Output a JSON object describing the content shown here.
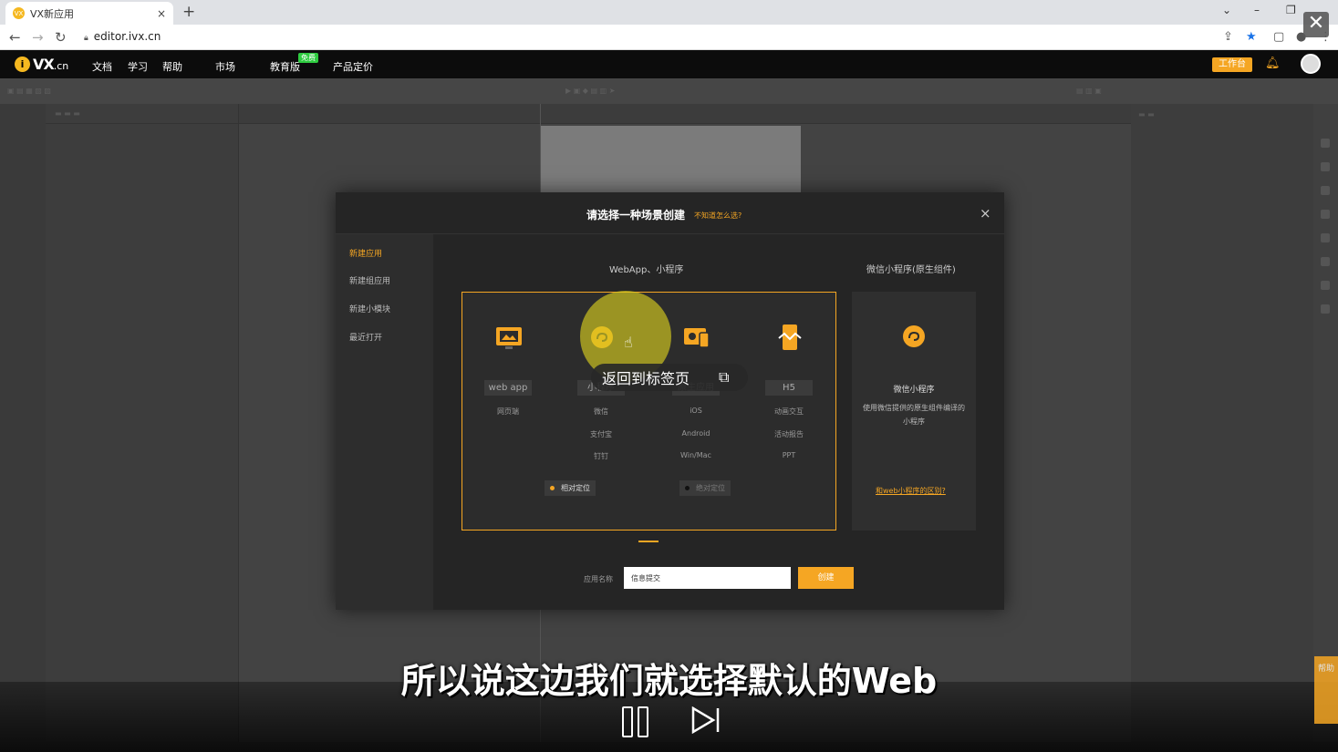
{
  "browser": {
    "tab_title": "VX新应用",
    "tab_close": "×",
    "new_tab": "+",
    "url": "editor.ivx.cn",
    "favicon": "VX"
  },
  "header": {
    "logo_text": "VX",
    "logo_suffix": ".cn",
    "nav": [
      "文档",
      "学习",
      "帮助",
      "市场",
      "教育版",
      "产品定价"
    ],
    "free_badge": "免费",
    "workbench": "工作台"
  },
  "modal": {
    "title": "请选择一种场景创建",
    "hint": "不知道怎么选?",
    "close": "×",
    "side_items": [
      "新建应用",
      "新建组应用",
      "新建小模块",
      "最近打开"
    ],
    "section_left": "WebApp、小程序",
    "section_right": "微信小程序(原生组件)",
    "options": [
      {
        "label": "web app",
        "subs": [
          "网页端"
        ]
      },
      {
        "label": "小程序",
        "subs": [
          "微信",
          "支付宝",
          "钉钉"
        ]
      },
      {
        "label": "原生应用",
        "subs": [
          "iOS",
          "Android",
          "Win/Mac"
        ]
      },
      {
        "label": "H5",
        "subs": [
          "动画交互",
          "活动报告",
          "PPT"
        ]
      }
    ],
    "pos_relative": "相对定位",
    "pos_absolute": "绝对定位",
    "mp_title": "微信小程序",
    "mp_desc": "使用微信提供的原生组件编译的小程序",
    "mp_link": "和web小程序的区别?",
    "name_label": "应用名称",
    "name_value": "信息提交",
    "create": "创建"
  },
  "overlay": {
    "back_to_tab": "返回到标签页",
    "subtitle": "所以说这边我们就选择默认的Web",
    "close": "✕",
    "help": "帮助"
  },
  "colors": {
    "accent": "#f5a623",
    "modal_bg": "#252525"
  }
}
